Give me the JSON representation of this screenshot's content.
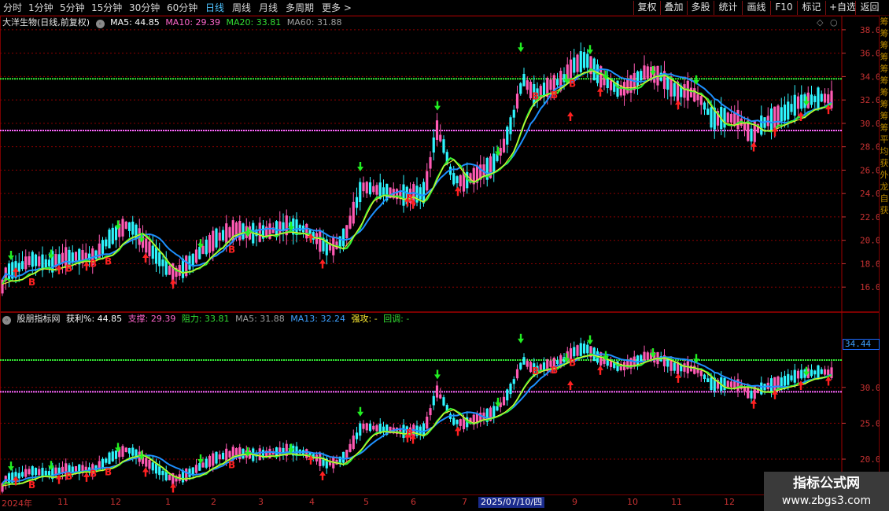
{
  "toolbar": {
    "timeframes": [
      "分时",
      "1分钟",
      "5分钟",
      "15分钟",
      "30分钟",
      "60分钟",
      "日线",
      "周线",
      "月线",
      "多周期",
      "更多"
    ],
    "active_timeframe": "日线",
    "more_arrow": ">",
    "buttons": [
      "复权",
      "叠加",
      "多股",
      "统计",
      "画线",
      "F10",
      "标记",
      "+自选",
      "返回"
    ]
  },
  "main_panel": {
    "stock_name": "大洋生物(日线,前复权)",
    "ma5": "MA5: 44.85",
    "ma10": "MA10: 29.39",
    "ma20": "MA20: 33.81",
    "ma60": "MA60: 31.88",
    "collapse_icon": "◇",
    "close_icon": "○"
  },
  "sub_panel": {
    "indicator_name": "股朋指标网",
    "profit": "获利%: 44.85",
    "support": "支撑: 29.39",
    "resistance": "阻力: 33.81",
    "ma5": "MA5: 31.88",
    "ma13": "MA13: 32.24",
    "strong_attack": "强攻: -",
    "pullback": "回调: -",
    "current_price_tag": "34.44"
  },
  "right_strip_text": "筹筹筹筹筹筹筹筹筹筹平均获外龙自获",
  "date_axis": {
    "labels": [
      "2024年",
      "11",
      "12",
      "1",
      "2",
      "3",
      "4",
      "5",
      "6",
      "7",
      "9",
      "10",
      "11",
      "12"
    ],
    "highlight": "2025/07/10/四"
  },
  "watermark": {
    "line1": "指标公式网",
    "line2": "www.zbgs3.com"
  },
  "colors": {
    "background": "#000000",
    "grid": "#8b0000",
    "axis_label": "#c83232",
    "ma5": "#ffffff",
    "ma10": "#ff66cc",
    "ma20": "#33dd33",
    "ma60": "#c8c8c8",
    "up_candle": "#ff5ab4",
    "down_candle": "#2ef5ff",
    "line_blue": "#1e90ff",
    "line_green": "#33ee33",
    "line_yellow": "#ffee33",
    "resistance_line": "#33ee33",
    "support_line": "#ff66ff",
    "buy_arrow": "#ff2020",
    "sell_arrow": "#22ee22",
    "b_mark": "#ff2020"
  },
  "chart_data": [
    {
      "type": "candlestick",
      "title": "大洋生物(日线,前复权)",
      "y_ticks": [
        16.0,
        18.0,
        20.0,
        22.0,
        24.0,
        26.0,
        28.0,
        30.0,
        32.0,
        34.0,
        36.0,
        38.0
      ],
      "ylim": [
        14.4,
        38.8
      ],
      "resistance_level": 33.81,
      "support_level": 29.39,
      "close_path": [
        [
          0,
          15.3
        ],
        [
          8,
          17.3
        ],
        [
          20,
          17.5
        ],
        [
          40,
          18.4
        ],
        [
          60,
          18.0
        ],
        [
          80,
          18.5
        ],
        [
          100,
          18.6
        ],
        [
          120,
          18.6
        ],
        [
          140,
          20.2
        ],
        [
          160,
          21.3
        ],
        [
          170,
          21.0
        ],
        [
          185,
          19.6
        ],
        [
          200,
          18.6
        ],
        [
          220,
          17.1
        ],
        [
          235,
          17.7
        ],
        [
          255,
          19.0
        ],
        [
          275,
          20.2
        ],
        [
          300,
          20.9
        ],
        [
          320,
          20.6
        ],
        [
          345,
          20.8
        ],
        [
          365,
          21.3
        ],
        [
          385,
          21.0
        ],
        [
          400,
          20.3
        ],
        [
          415,
          19.4
        ],
        [
          430,
          19.6
        ],
        [
          440,
          20.6
        ],
        [
          450,
          22.5
        ],
        [
          460,
          24.6
        ],
        [
          480,
          24.3
        ],
        [
          500,
          24.0
        ],
        [
          520,
          23.8
        ],
        [
          540,
          24.1
        ],
        [
          555,
          29.5
        ],
        [
          565,
          27.9
        ],
        [
          575,
          25.3
        ],
        [
          590,
          25.0
        ],
        [
          610,
          25.8
        ],
        [
          625,
          26.3
        ],
        [
          640,
          28.0
        ],
        [
          650,
          30.0
        ],
        [
          665,
          33.8
        ],
        [
          680,
          32.3
        ],
        [
          700,
          33.3
        ],
        [
          715,
          33.7
        ],
        [
          730,
          35.0
        ],
        [
          745,
          35.5
        ],
        [
          760,
          34.2
        ],
        [
          775,
          33.3
        ],
        [
          790,
          32.8
        ],
        [
          805,
          33.5
        ],
        [
          820,
          34.4
        ],
        [
          840,
          34.0
        ],
        [
          860,
          32.7
        ],
        [
          875,
          32.8
        ],
        [
          890,
          32.1
        ],
        [
          905,
          30.4
        ],
        [
          925,
          30.5
        ],
        [
          940,
          30.3
        ],
        [
          955,
          29.0
        ],
        [
          970,
          30.0
        ],
        [
          985,
          30.5
        ],
        [
          1000,
          31.0
        ],
        [
          1015,
          31.8
        ],
        [
          1030,
          32.0
        ],
        [
          1045,
          32.2
        ],
        [
          1060,
          32.0
        ]
      ],
      "buy_arrows": [
        [
          20,
          17.3
        ],
        [
          75,
          17.5
        ],
        [
          110,
          17.8
        ],
        [
          185,
          18.5
        ],
        [
          220,
          16.3
        ],
        [
          395,
          20.2
        ],
        [
          410,
          18.0
        ],
        [
          518,
          23.3
        ],
        [
          525,
          23.1
        ],
        [
          582,
          24.2
        ],
        [
          725,
          30.6
        ],
        [
          763,
          32.7
        ],
        [
          862,
          31.6
        ],
        [
          958,
          28.0
        ],
        [
          985,
          29.3
        ],
        [
          1018,
          30.6
        ],
        [
          1053,
          31.2
        ]
      ],
      "sell_arrows": [
        [
          14,
          18.7
        ],
        [
          65,
          18.8
        ],
        [
          150,
          21.3
        ],
        [
          180,
          20.2
        ],
        [
          255,
          19.7
        ],
        [
          315,
          20.7
        ],
        [
          370,
          21.2
        ],
        [
          458,
          26.3
        ],
        [
          556,
          31.5
        ],
        [
          633,
          27.6
        ],
        [
          662,
          36.5
        ],
        [
          720,
          33.8
        ],
        [
          750,
          36.3
        ],
        [
          770,
          34.1
        ],
        [
          830,
          34.5
        ],
        [
          885,
          33.7
        ],
        [
          1025,
          31.9
        ]
      ],
      "b_marks": [
        [
          40,
          16.4
        ],
        [
          87,
          17.6
        ],
        [
          118,
          18.0
        ],
        [
          137,
          18.2
        ],
        [
          294,
          19.2
        ],
        [
          520,
          23.6
        ],
        [
          680,
          32.3
        ],
        [
          704,
          32.4
        ],
        [
          727,
          33.4
        ]
      ]
    },
    {
      "type": "candlestick",
      "title": "股朋指标网",
      "y_ticks": [
        20.0,
        25.0,
        30.0
      ],
      "ylim": [
        15.4,
        38.3
      ],
      "resistance_level": 33.81,
      "support_level": 29.39,
      "price_tag": 34.44
    }
  ]
}
